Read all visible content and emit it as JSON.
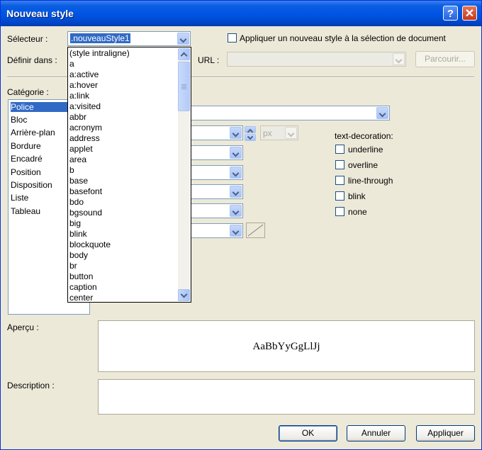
{
  "window": {
    "title": "Nouveau style"
  },
  "titlebar": {
    "help_glyph": "?",
    "close_glyph": "✕"
  },
  "selector": {
    "label": "Sélecteur :",
    "value": ".nouveauStyle1"
  },
  "apply_selection": {
    "label": "Appliquer un nouveau style à la sélection de document",
    "checked": false
  },
  "define_in": {
    "label": "Définir dans :"
  },
  "url": {
    "label": "URL :",
    "value": "",
    "browse_label": "Parcourir..."
  },
  "category": {
    "label": "Catégorie :",
    "items": [
      "Police",
      "Bloc",
      "Arrière-plan",
      "Bordure",
      "Encadré",
      "Position",
      "Disposition",
      "Liste",
      "Tableau"
    ],
    "selected": "Police"
  },
  "selector_dropdown": {
    "items": [
      "(style intraligne)",
      "a",
      "a:active",
      "a:hover",
      "a:link",
      "a:visited",
      "abbr",
      "acronym",
      "address",
      "applet",
      "area",
      "b",
      "base",
      "basefont",
      "bdo",
      "bgsound",
      "big",
      "blink",
      "blockquote",
      "body",
      "br",
      "button",
      "caption",
      "center"
    ]
  },
  "font_props": {
    "unit_value": "px"
  },
  "text_decoration": {
    "label": "text-decoration:",
    "options": [
      "underline",
      "overline",
      "line-through",
      "blink",
      "none"
    ]
  },
  "preview": {
    "label": "Aperçu :",
    "sample": "AaBbYyGgLlJj"
  },
  "description": {
    "label": "Description :",
    "value": ""
  },
  "buttons": {
    "ok": "OK",
    "cancel": "Annuler",
    "apply": "Appliquer"
  },
  "colors": {
    "title_bar": "#0054e3",
    "selection": "#316ac5",
    "dialog_bg": "#ece9d8"
  }
}
